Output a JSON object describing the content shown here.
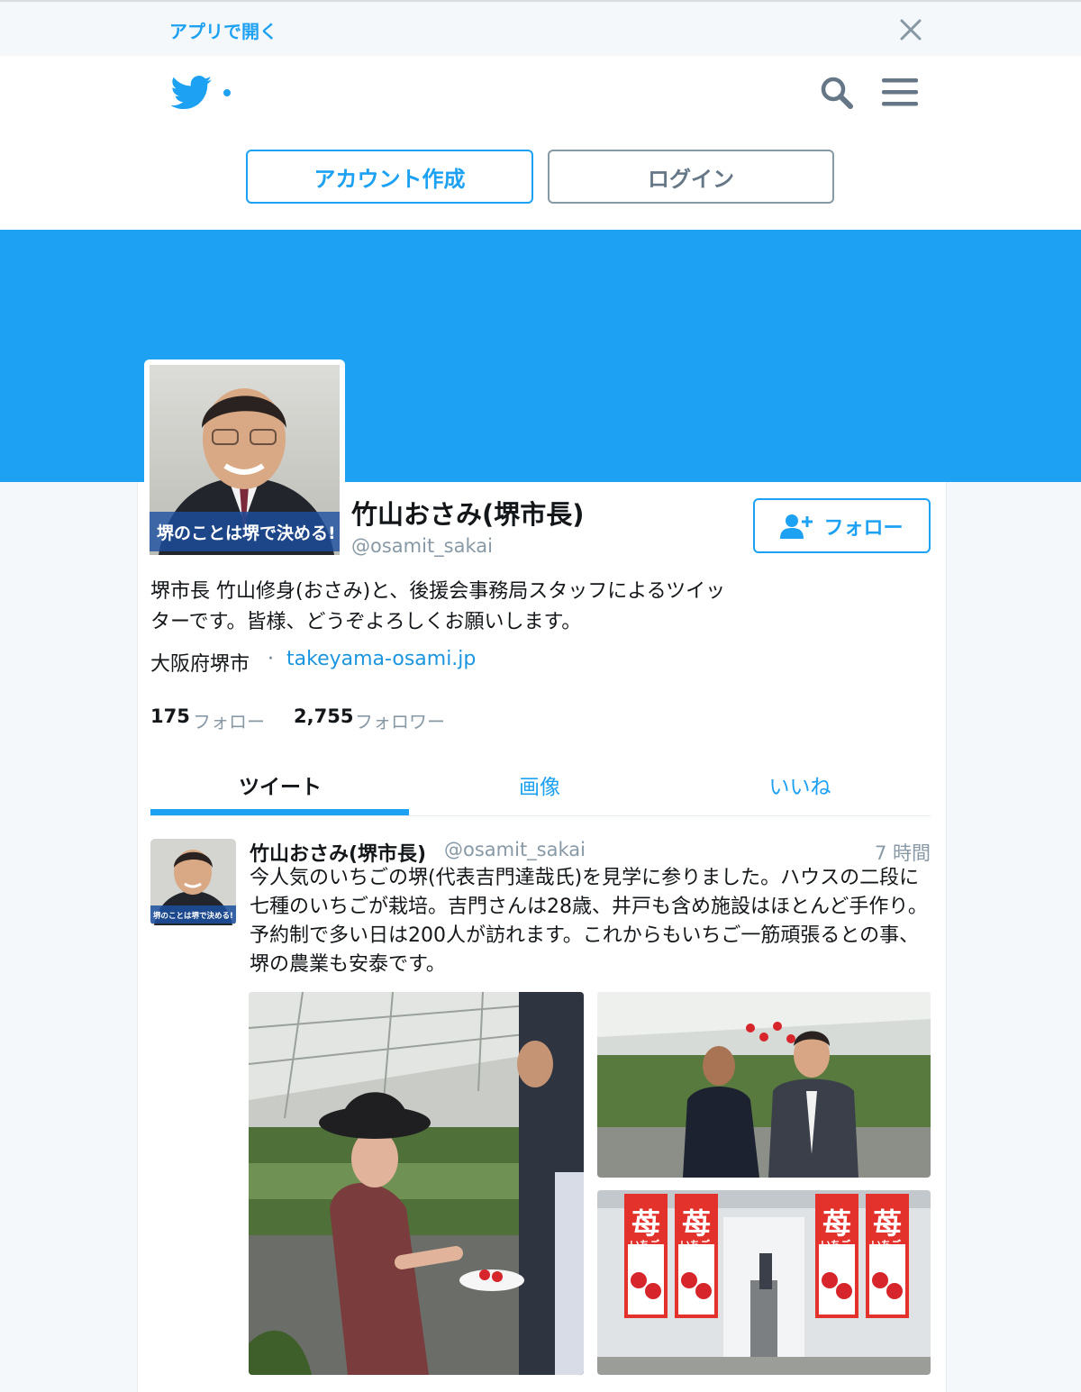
{
  "app_banner": {
    "open_in_app": "アプリで開く",
    "close_icon": "close-icon"
  },
  "header": {
    "logo_icon": "twitter-bird-icon",
    "search_icon": "search-icon",
    "menu_icon": "hamburger-menu-icon",
    "signup_label": "アカウント作成",
    "login_label": "ログイン"
  },
  "profile": {
    "name": "竹山おさみ(堺市長)",
    "handle": "@osamit_sakai",
    "follow_label": "フォロー",
    "bio": "堺市長 竹山修身(おさみ)と、後援会事務局スタッフによるツイッターです。皆様、どうぞよろしくお願いします。",
    "location": "大阪府堺市",
    "separator": "·",
    "url": "takeyama-osami.jp",
    "avatar_caption": "堺のことは堺で決める!",
    "following_count": "175",
    "following_label": "フォロー",
    "followers_count": "2,755",
    "followers_label": "フォロワー",
    "accent_color": "#1da1f2"
  },
  "tabs": [
    {
      "label": "ツイート",
      "active": true
    },
    {
      "label": "画像",
      "active": false
    },
    {
      "label": "いいね",
      "active": false
    }
  ],
  "tweet": {
    "name": "竹山おさみ(堺市長)",
    "handle": "@osamit_sakai",
    "time": "7 時間",
    "avatar_caption": "堺のことは堺で決める!",
    "text": "今人気のいちごの堺(代表吉門達哉氏)を見学に参りました。ハウスの二段に七種のいちごが栽培。吉門さんは28歳、井戸も含め施設はほとんど手作り。予約制で多い日は200人が訪れます。これからもいちご一筋頑張るとの事、堺の農業も安泰です。",
    "photo_banner_text": "苺",
    "photo_banner_sub": "いちご"
  }
}
